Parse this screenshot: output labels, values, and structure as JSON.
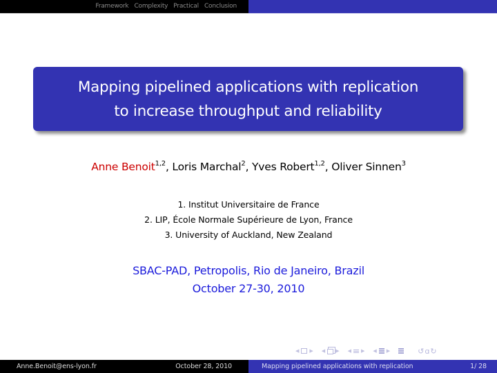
{
  "header": {
    "sections": [
      "Framework",
      "Complexity",
      "Practical",
      "Conclusion"
    ]
  },
  "title": {
    "line1": "Mapping pipelined applications with replication",
    "line2": "to increase throughput and reliability"
  },
  "authors": [
    {
      "name": "Anne Benoit",
      "affil": "1,2",
      "presenter": true
    },
    {
      "name": "Loris Marchal",
      "affil": "2",
      "presenter": false
    },
    {
      "name": "Yves Robert",
      "affil": "1,2",
      "presenter": false
    },
    {
      "name": "Oliver Sinnen",
      "affil": "3",
      "presenter": false
    }
  ],
  "author_separator": ", ",
  "affiliations": [
    "1. Institut Universitaire de France",
    "2. LIP, École Normale Supérieure de Lyon, France",
    "3. University of Auckland, New Zealand"
  ],
  "conference": {
    "name": "SBAC-PAD, Petropolis, Rio de Janeiro, Brazil",
    "dates": "October 27-30, 2010"
  },
  "nav_symbols": {
    "icons": [
      "frame-nav-icon",
      "subsection-nav-icon",
      "section-nav-icon",
      "presentation-nav-icon",
      "appendix-nav-icon",
      "search-back-forward-icon"
    ],
    "search_glyphs": "↺ɑ↻"
  },
  "footer": {
    "author_email": "Anne.Benoit@ens-lyon.fr",
    "date": "October 28, 2010",
    "short_title": "Mapping pipelined applications with replication",
    "page": "1/ 28"
  },
  "colors": {
    "beamer_blue": "#3333b2",
    "presenter_red": "#cc0000",
    "conference_blue": "#1a1adb",
    "header_black": "#000000"
  }
}
